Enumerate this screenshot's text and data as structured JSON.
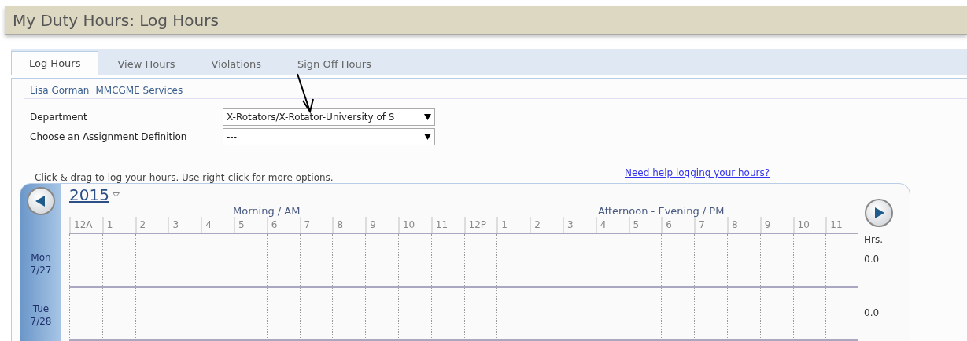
{
  "header": {
    "title": "My Duty Hours: Log Hours"
  },
  "tabs": [
    {
      "label": "Log Hours",
      "selected": true
    },
    {
      "label": "View Hours",
      "selected": false
    },
    {
      "label": "Violations",
      "selected": false
    },
    {
      "label": "Sign Off Hours",
      "selected": false
    }
  ],
  "user": {
    "name": "Lisa Gorman",
    "organization": "MMCGME Services"
  },
  "form": [
    {
      "label": "Department",
      "value": "X-Rotators/X-Rotator-University of S"
    },
    {
      "label": "Choose an Assignment Definition",
      "value": "---"
    }
  ],
  "hint": "Click & drag to log your hours. Use right-click for more options.",
  "help_link": "Need help logging your hours?",
  "calendar": {
    "year": "2015",
    "periods": [
      "Morning / AM",
      "Afternoon - Evening / PM"
    ],
    "hours": [
      "12A",
      "1",
      "2",
      "3",
      "4",
      "5",
      "6",
      "7",
      "8",
      "9",
      "10",
      "11",
      "12P",
      "1",
      "2",
      "3",
      "4",
      "5",
      "6",
      "7",
      "8",
      "9",
      "10",
      "11"
    ],
    "total_label": "Hrs.",
    "days": [
      {
        "day": "Mon",
        "date": "7/27",
        "total": "0.0"
      },
      {
        "day": "Tue",
        "date": "7/28",
        "total": "0.0"
      }
    ]
  }
}
